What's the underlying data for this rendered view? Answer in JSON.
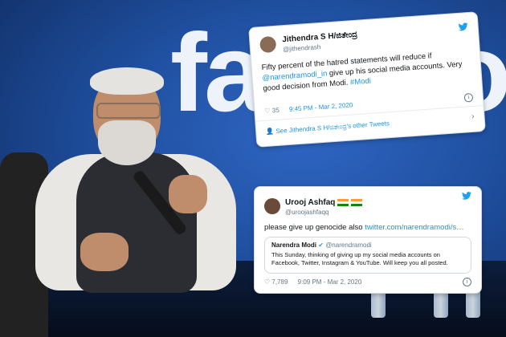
{
  "background": {
    "brand_text": "facebook"
  },
  "tweet1": {
    "name": "Jithendra S H/ಜಿತೇಂದ್ರ",
    "handle": "@jithendrash",
    "text_parts": [
      "Fifty percent of the hatred statements will reduce if ",
      "@narendramodi_in",
      " give up his social media accounts. Very good decision from Modi. ",
      "#Modi"
    ],
    "likes": "35",
    "time": "9:45 PM - Mar 2, 2020",
    "see_more": "See Jithendra S H/ಜಿತೇಂದ್ರ's other Tweets",
    "info_glyph": "i",
    "chevron": "›"
  },
  "tweet2": {
    "name": "Urooj Ashfaq",
    "handle": "@uroojashfaqq",
    "text": "please give up genocide also ",
    "link": "twitter.com/narendramodi/s…",
    "quoted": {
      "name": "Narendra Modi",
      "handle": "@narendramodi",
      "text": "This Sunday, thinking of giving up my social media accounts on Facebook, Twitter, Instagram & YouTube. Will keep you all posted."
    },
    "likes": "7,789",
    "time": "9:09 PM - Mar 2, 2020",
    "info_glyph": "i"
  },
  "colors": {
    "twitter_blue": "#1da1f2",
    "link_blue": "#1b95e0",
    "facebook_blue": "#2f66c4"
  },
  "icons": {
    "twitter": "twitter-bird-icon",
    "heart": "heart-icon",
    "info": "info-icon",
    "verified": "verified-badge-icon"
  }
}
